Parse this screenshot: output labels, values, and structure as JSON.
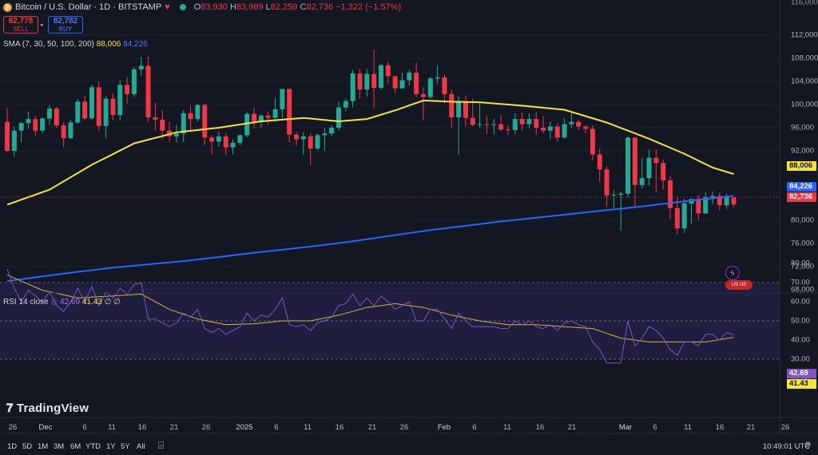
{
  "header": {
    "symbol": "Bitcoin / U.S. Dollar · 1D · BITSTAMP",
    "coin_glyph": "₿",
    "open_label": "O",
    "open": "83,930",
    "high_label": "H",
    "high": "83,989",
    "low_label": "L",
    "low": "82,259",
    "close_label": "C",
    "close": "82,736",
    "change": "−1,322 (−1.57%)"
  },
  "trade": {
    "sell_price": "82,778",
    "sell_label": "SELL",
    "buy_price": "82,782",
    "buy_label": "BUY"
  },
  "sma_legend": {
    "label": "SMA (7, 30, 50, 100, 200)",
    "value1": "88,006",
    "value2": "84,226"
  },
  "rsi_legend": {
    "label": "RSI 14 close",
    "value1": "42.69",
    "value2": "41.43",
    "tail": "∅ ∅"
  },
  "price_axis": [
    "112,000",
    "108,000",
    "104,000",
    "100,000",
    "96,000",
    "92,000",
    "80,000",
    "76,000",
    "72,000",
    "68,000"
  ],
  "price_badges": {
    "sma_long": "88,006",
    "sma_short": "84,226",
    "last": "82,736"
  },
  "rsi_axis": [
    "80.00",
    "70.00",
    "60.00",
    "50.00",
    "40.00",
    "30.00",
    "20.00"
  ],
  "rsi_badges": {
    "rsi": "42.69",
    "rsi_ma": "41.43"
  },
  "time_axis": [
    "26",
    "Dec",
    "6",
    "11",
    "16",
    "21",
    "26",
    "2025",
    "6",
    "11",
    "16",
    "21",
    "26",
    "Feb",
    "6",
    "11",
    "16",
    "21",
    "Mar",
    "6",
    "11",
    "16",
    "21",
    "26"
  ],
  "ranges": [
    "1D",
    "5D",
    "1M",
    "3M",
    "6M",
    "YTD",
    "1Y",
    "5Y",
    "All"
  ],
  "clock": "10:49:01 UTC",
  "brand": "TradingView",
  "colors": {
    "up": "#22ab94",
    "down": "#f23645",
    "sma_long": "#f5e23c",
    "sma_short": "#2962ff",
    "rsi": "#7e57c2",
    "rsi_ma": "#d4b63a",
    "bg": "#131722"
  },
  "chart_data": [
    {
      "type": "candlestick",
      "title": "Bitcoin / U.S. Dollar · 1D · BITSTAMP",
      "ylim": [
        66000,
        116000
      ],
      "candles": [
        [
          97000,
          99500,
          91800,
          92000
        ],
        [
          92000,
          96200,
          91000,
          95500
        ],
        [
          95500,
          97000,
          93500,
          96800
        ],
        [
          96800,
          98800,
          95800,
          97500
        ],
        [
          97500,
          98000,
          94600,
          95500
        ],
        [
          95500,
          97800,
          95000,
          97600
        ],
        [
          97600,
          99900,
          96500,
          99300
        ],
        [
          99300,
          99600,
          96000,
          96400
        ],
        [
          96400,
          97000,
          92600,
          94200
        ],
        [
          94200,
          97300,
          94000,
          96900
        ],
        [
          96900,
          101000,
          96700,
          100500
        ],
        [
          100500,
          101500,
          97300,
          97600
        ],
        [
          97600,
          103500,
          97400,
          103000
        ],
        [
          103000,
          104000,
          95500,
          96300
        ],
        [
          96300,
          101500,
          94200,
          101000
        ],
        [
          101000,
          102000,
          97300,
          98200
        ],
        [
          98200,
          104200,
          97300,
          103400
        ],
        [
          103400,
          104800,
          100200,
          101800
        ],
        [
          101800,
          106500,
          101300,
          106100
        ],
        [
          106100,
          108200,
          105000,
          106700
        ],
        [
          106700,
          108300,
          97000,
          97800
        ],
        [
          97800,
          100300,
          95500,
          97400
        ],
        [
          97400,
          99000,
          94000,
          95500
        ],
        [
          95500,
          97000,
          93500,
          94500
        ],
        [
          94500,
          96500,
          93500,
          95000
        ],
        [
          95000,
          99000,
          93500,
          98500
        ],
        [
          98500,
          99900,
          95300,
          97500
        ],
        [
          97500,
          100100,
          97100,
          99900
        ],
        [
          99900,
          100200,
          93000,
          94300
        ],
        [
          94300,
          94700,
          91300,
          93600
        ],
        [
          93600,
          95300,
          92700,
          94500
        ],
        [
          94500,
          95000,
          91300,
          92600
        ],
        [
          92600,
          94000,
          91400,
          93400
        ],
        [
          93400,
          94900,
          93000,
          94700
        ],
        [
          94700,
          98700,
          94300,
          98400
        ],
        [
          98400,
          99500,
          95900,
          97000
        ],
        [
          97000,
          98300,
          96000,
          98100
        ],
        [
          98100,
          98800,
          96500,
          97700
        ],
        [
          97700,
          101200,
          97000,
          99200
        ],
        [
          99200,
          102700,
          97700,
          102700
        ],
        [
          102700,
          102500,
          93500,
          94800
        ],
        [
          94800,
          95200,
          92900,
          94000
        ],
        [
          94000,
          95200,
          91300,
          94500
        ],
        [
          94500,
          95000,
          89500,
          92400
        ],
        [
          92400,
          95000,
          92200,
          94700
        ],
        [
          94700,
          96000,
          92000,
          95000
        ],
        [
          95000,
          96500,
          94500,
          96000
        ],
        [
          96000,
          100500,
          95500,
          99500
        ],
        [
          99500,
          101000,
          98800,
          100600
        ],
        [
          100600,
          106000,
          99500,
          105400
        ],
        [
          105400,
          106200,
          101000,
          102600
        ],
        [
          102600,
          106200,
          101400,
          105300
        ],
        [
          105300,
          109500,
          99300,
          102900
        ],
        [
          102900,
          107000,
          102600,
          106800
        ],
        [
          106800,
          107400,
          103500,
          104900
        ],
        [
          104900,
          104700,
          102000,
          102800
        ],
        [
          102800,
          105500,
          103000,
          104200
        ],
        [
          104200,
          106000,
          103300,
          105500
        ],
        [
          105500,
          107200,
          101300,
          101800
        ],
        [
          101800,
          103000,
          97300,
          101300
        ],
        [
          101300,
          104800,
          101000,
          104500
        ],
        [
          104500,
          106800,
          103600,
          104700
        ],
        [
          104700,
          105200,
          100200,
          101800
        ],
        [
          101800,
          102600,
          96000,
          97800
        ],
        [
          97800,
          101500,
          91300,
          100600
        ],
        [
          100600,
          101600,
          96200,
          97700
        ],
        [
          97700,
          101000,
          96200,
          96500
        ],
        [
          96500,
          100300,
          96000,
          96600
        ],
        [
          96600,
          98100,
          94900,
          96500
        ],
        [
          96500,
          97500,
          94800,
          96600
        ],
        [
          96600,
          98200,
          95400,
          95700
        ],
        [
          95700,
          96400,
          94800,
          95600
        ],
        [
          95600,
          98500,
          94800,
          97500
        ],
        [
          97500,
          98600,
          95600,
          96600
        ],
        [
          96600,
          98500,
          95900,
          97500
        ],
        [
          97500,
          98700,
          94800,
          96000
        ],
        [
          96000,
          98000,
          95000,
          95500
        ],
        [
          95500,
          97000,
          94000,
          96200
        ],
        [
          96200,
          96800,
          93600,
          94300
        ],
        [
          94300,
          97600,
          94200,
          96600
        ],
        [
          96600,
          98800,
          96000,
          97000
        ],
        [
          97000,
          97300,
          95500,
          96200
        ],
        [
          96200,
          96500,
          95000,
          95800
        ],
        [
          95800,
          96400,
          90300,
          91400
        ],
        [
          91400,
          92400,
          86600,
          88800
        ],
        [
          88800,
          89300,
          82400,
          84300
        ],
        [
          84300,
          85200,
          82100,
          84400
        ],
        [
          84400,
          85000,
          78200,
          84600
        ],
        [
          84600,
          94500,
          84000,
          94300
        ],
        [
          94300,
          94300,
          82100,
          86100
        ],
        [
          86100,
          90800,
          85500,
          87300
        ],
        [
          87300,
          92200,
          86000,
          90800
        ],
        [
          90800,
          92200,
          84800,
          89900
        ],
        [
          89900,
          90500,
          85300,
          86900
        ],
        [
          86900,
          87600,
          80200,
          82100
        ],
        [
          82100,
          84000,
          77500,
          78600
        ],
        [
          78600,
          83700,
          77800,
          82900
        ],
        [
          82900,
          83600,
          79400,
          83700
        ],
        [
          83700,
          84400,
          80000,
          81200
        ],
        [
          81200,
          84900,
          81100,
          84000
        ],
        [
          84000,
          85000,
          82800,
          84200
        ],
        [
          84200,
          84800,
          81800,
          82600
        ],
        [
          82600,
          84600,
          82000,
          84100
        ],
        [
          83930,
          83989,
          82259,
          82736
        ]
      ],
      "sma_short": [
        [
          0,
          69500
        ],
        [
          5,
          70300
        ],
        [
          10,
          71100
        ],
        [
          15,
          71800
        ],
        [
          20,
          72400
        ],
        [
          25,
          72950
        ],
        [
          30,
          73650
        ],
        [
          35,
          74400
        ],
        [
          40,
          75050
        ],
        [
          45,
          75750
        ],
        [
          50,
          76550
        ],
        [
          55,
          77450
        ],
        [
          60,
          78300
        ],
        [
          65,
          79050
        ],
        [
          70,
          79800
        ],
        [
          75,
          80450
        ],
        [
          80,
          81100
        ],
        [
          85,
          81750
        ],
        [
          90,
          82400
        ],
        [
          95,
          83150
        ],
        [
          100,
          83800
        ],
        [
          103,
          84226
        ]
      ],
      "sma_long": [
        [
          0,
          82700
        ],
        [
          6,
          85300
        ],
        [
          12,
          89600
        ],
        [
          18,
          93300
        ],
        [
          24,
          95200
        ],
        [
          30,
          96000
        ],
        [
          36,
          97100
        ],
        [
          42,
          97700
        ],
        [
          47,
          97100
        ],
        [
          51,
          97500
        ],
        [
          55,
          99000
        ],
        [
          59,
          100700
        ],
        [
          63,
          100500
        ],
        [
          67,
          100400
        ],
        [
          73,
          99800
        ],
        [
          79,
          99100
        ],
        [
          85,
          96900
        ],
        [
          91,
          94100
        ],
        [
          96,
          91500
        ],
        [
          100,
          89100
        ],
        [
          103,
          88006
        ]
      ],
      "rsi": [
        [
          0,
          77
        ],
        [
          1,
          67
        ],
        [
          2,
          60
        ],
        [
          3,
          66
        ],
        [
          4,
          63
        ],
        [
          5,
          60
        ],
        [
          6,
          65
        ],
        [
          7,
          58
        ],
        [
          8,
          55
        ],
        [
          9,
          60
        ],
        [
          10,
          67
        ],
        [
          11,
          60
        ],
        [
          12,
          68
        ],
        [
          13,
          58
        ],
        [
          14,
          65
        ],
        [
          15,
          62
        ],
        [
          16,
          67
        ],
        [
          17,
          64
        ],
        [
          18,
          69
        ],
        [
          19,
          70
        ],
        [
          20,
          51
        ],
        [
          21,
          51
        ],
        [
          22,
          49
        ],
        [
          23,
          47
        ],
        [
          24,
          49
        ],
        [
          25,
          54
        ],
        [
          26,
          52
        ],
        [
          27,
          56
        ],
        [
          28,
          46
        ],
        [
          29,
          44
        ],
        [
          30,
          46
        ],
        [
          31,
          43
        ],
        [
          32,
          45
        ],
        [
          33,
          47
        ],
        [
          34,
          54
        ],
        [
          35,
          50
        ],
        [
          36,
          53
        ],
        [
          37,
          52
        ],
        [
          38,
          56
        ],
        [
          39,
          62
        ],
        [
          40,
          48
        ],
        [
          41,
          47
        ],
        [
          42,
          48
        ],
        [
          43,
          45
        ],
        [
          44,
          49
        ],
        [
          45,
          50
        ],
        [
          46,
          52
        ],
        [
          47,
          58
        ],
        [
          48,
          59
        ],
        [
          49,
          64
        ],
        [
          50,
          58
        ],
        [
          51,
          62
        ],
        [
          52,
          58
        ],
        [
          53,
          63
        ],
        [
          54,
          60
        ],
        [
          55,
          56
        ],
        [
          56,
          58
        ],
        [
          57,
          60
        ],
        [
          58,
          50
        ],
        [
          59,
          50
        ],
        [
          60,
          56
        ],
        [
          61,
          56
        ],
        [
          62,
          51
        ],
        [
          63,
          46
        ],
        [
          64,
          54
        ],
        [
          65,
          50
        ],
        [
          66,
          47
        ],
        [
          67,
          47
        ],
        [
          68,
          47
        ],
        [
          69,
          47
        ],
        [
          70,
          46
        ],
        [
          71,
          46
        ],
        [
          72,
          50
        ],
        [
          73,
          48
        ],
        [
          74,
          50
        ],
        [
          75,
          47
        ],
        [
          76,
          46
        ],
        [
          77,
          48
        ],
        [
          78,
          45
        ],
        [
          79,
          49
        ],
        [
          80,
          50
        ],
        [
          81,
          48
        ],
        [
          82,
          47
        ],
        [
          83,
          39
        ],
        [
          84,
          35
        ],
        [
          85,
          28
        ],
        [
          86,
          28
        ],
        [
          87,
          28
        ],
        [
          88,
          50
        ],
        [
          89,
          37
        ],
        [
          90,
          41
        ],
        [
          91,
          47
        ],
        [
          92,
          45
        ],
        [
          93,
          41
        ],
        [
          94,
          35
        ],
        [
          95,
          32
        ],
        [
          96,
          39
        ],
        [
          97,
          39
        ],
        [
          98,
          37
        ],
        [
          99,
          43
        ],
        [
          100,
          43
        ],
        [
          101,
          40
        ],
        [
          102,
          44
        ],
        [
          103,
          42.69
        ]
      ],
      "rsi_ma": [
        [
          0,
          74
        ],
        [
          5,
          66
        ],
        [
          10,
          62
        ],
        [
          15,
          63
        ],
        [
          19,
          64
        ],
        [
          23,
          56
        ],
        [
          27,
          51
        ],
        [
          31,
          48
        ],
        [
          35,
          48.5
        ],
        [
          39,
          50
        ],
        [
          43,
          50
        ],
        [
          47,
          53
        ],
        [
          51,
          57
        ],
        [
          55,
          59
        ],
        [
          59,
          57
        ],
        [
          63,
          53
        ],
        [
          67,
          50
        ],
        [
          71,
          48
        ],
        [
          75,
          48
        ],
        [
          79,
          47
        ],
        [
          83,
          46
        ],
        [
          87,
          41
        ],
        [
          91,
          39
        ],
        [
          95,
          39
        ],
        [
          99,
          39
        ],
        [
          103,
          41.43
        ]
      ],
      "rsi_bands": [
        30,
        50,
        70
      ],
      "rsi_ylim": [
        15,
        85
      ]
    }
  ]
}
